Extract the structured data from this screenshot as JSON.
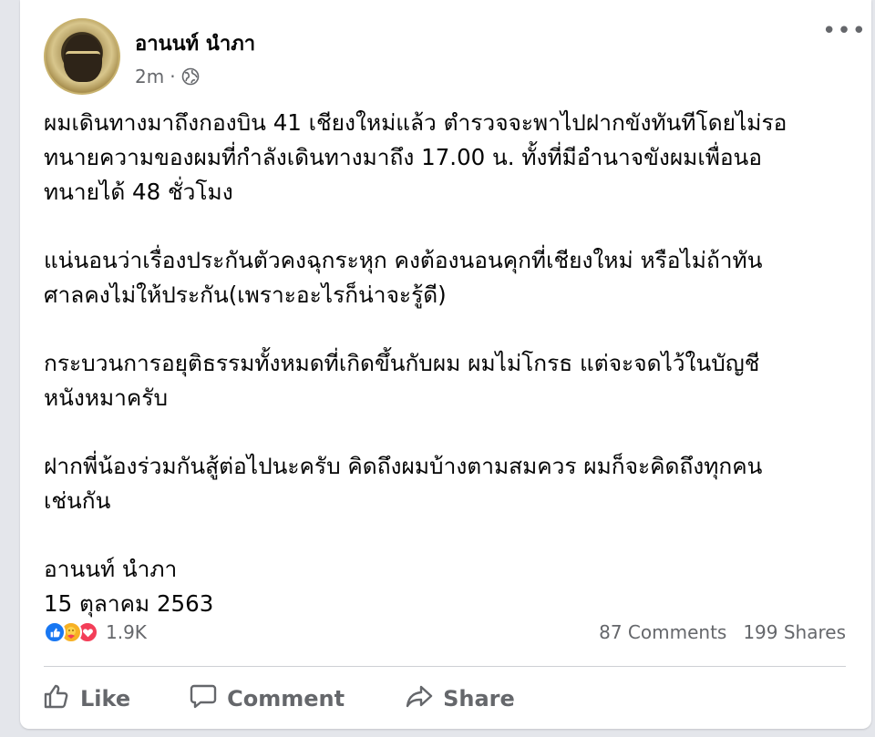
{
  "post": {
    "author": "อานนท์ นำภา",
    "time": "2m",
    "separator": "·",
    "paragraphs": [
      [
        "ผมเดินทางมาถึงกองบิน 41 เชียงใหม่แล้ว ตำรวจจะพาไปฝากขังทันทีโดยไม่รอ",
        "ทนายความของผมที่กำลังเดินทางมาถึง 17.00 น. ทั้งที่มีอำนาจขังผมเพื่อนอ",
        "ทนายได้ 48 ชั่วโมง"
      ],
      [
        "แน่นอนว่าเรื่องประกันตัวคงฉุกระหุก คงต้องนอนคุกที่เชียงใหม่ หรือไม่ถ้าทัน",
        "ศาลคงไม่ให้ประกัน(เพราะอะไรก็น่าจะรู้ดี)"
      ],
      [
        "กระบวนการอยุติธรรมทั้งหมดที่เกิดขึ้นกับผม ผมไม่โกรธ แต่จะจดไว้ในบัญชี",
        "หนังหมาครับ"
      ],
      [
        "ฝากพี่น้องร่วมกันสู้ต่อไปนะครับ คิดถึงผมบ้างตามสมควร ผมก็จะคิดถึงทุกคน",
        "เช่นกัน"
      ],
      [
        "อานนท์ นำภา",
        "15 ตุลาคม 2563"
      ]
    ]
  },
  "stats": {
    "reactions_count": "1.9K",
    "comments": "87 Comments",
    "shares": "199 Shares"
  },
  "actions": {
    "like": "Like",
    "comment": "Comment",
    "share": "Share"
  },
  "colors": {
    "like_blue": "#1877f2",
    "care_yellow": "#f7b125",
    "love_red": "#f33e58",
    "secondary_text": "#65676b"
  }
}
